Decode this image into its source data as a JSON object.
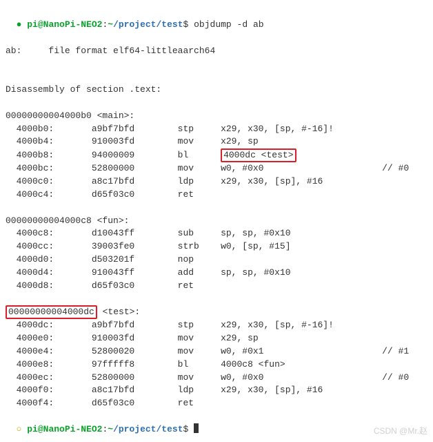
{
  "prompt1": {
    "bullet": "●",
    "userhost": "pi@NanoPi-NEO2",
    "colon": ":",
    "tilde": "~",
    "path": "/project/test",
    "dollar": "$",
    "command": "objdump -d ab"
  },
  "file_line": "ab:     file format elf64-littleaarch64",
  "section_line": "Disassembly of section .text:",
  "main": {
    "header": "00000000004000b0 <main>:",
    "rows": [
      {
        "addr": "  4000b0:",
        "hex": "a9bf7bfd",
        "mnemonic": "stp",
        "ops": "x29, x30, [sp, #-16]!",
        "comment": ""
      },
      {
        "addr": "  4000b4:",
        "hex": "910003fd",
        "mnemonic": "mov",
        "ops": "x29, sp",
        "comment": ""
      },
      {
        "addr": "  4000b8:",
        "hex": "94000009",
        "mnemonic": "bl",
        "ops": "4000dc <test>",
        "comment": "",
        "highlight_ops": true
      },
      {
        "addr": "  4000bc:",
        "hex": "52800000",
        "mnemonic": "mov",
        "ops": "w0, #0x0",
        "comment": "// #0"
      },
      {
        "addr": "  4000c0:",
        "hex": "a8c17bfd",
        "mnemonic": "ldp",
        "ops": "x29, x30, [sp], #16",
        "comment": ""
      },
      {
        "addr": "  4000c4:",
        "hex": "d65f03c0",
        "mnemonic": "ret",
        "ops": "",
        "comment": ""
      }
    ]
  },
  "fun": {
    "header": "00000000004000c8 <fun>:",
    "rows": [
      {
        "addr": "  4000c8:",
        "hex": "d10043ff",
        "mnemonic": "sub",
        "ops": "sp, sp, #0x10",
        "comment": ""
      },
      {
        "addr": "  4000cc:",
        "hex": "39003fe0",
        "mnemonic": "strb",
        "ops": "w0, [sp, #15]",
        "comment": ""
      },
      {
        "addr": "  4000d0:",
        "hex": "d503201f",
        "mnemonic": "nop",
        "ops": "",
        "comment": ""
      },
      {
        "addr": "  4000d4:",
        "hex": "910043ff",
        "mnemonic": "add",
        "ops": "sp, sp, #0x10",
        "comment": ""
      },
      {
        "addr": "  4000d8:",
        "hex": "d65f03c0",
        "mnemonic": "ret",
        "ops": "",
        "comment": ""
      }
    ]
  },
  "test": {
    "header_addr": "00000000004000dc",
    "header_sym": " <test>:",
    "rows": [
      {
        "addr": "  4000dc:",
        "hex": "a9bf7bfd",
        "mnemonic": "stp",
        "ops": "x29, x30, [sp, #-16]!",
        "comment": ""
      },
      {
        "addr": "  4000e0:",
        "hex": "910003fd",
        "mnemonic": "mov",
        "ops": "x29, sp",
        "comment": ""
      },
      {
        "addr": "  4000e4:",
        "hex": "52800020",
        "mnemonic": "mov",
        "ops": "w0, #0x1",
        "comment": "// #1"
      },
      {
        "addr": "  4000e8:",
        "hex": "97fffff8",
        "mnemonic": "bl",
        "ops": "4000c8 <fun>",
        "comment": ""
      },
      {
        "addr": "  4000ec:",
        "hex": "52800000",
        "mnemonic": "mov",
        "ops": "w0, #0x0",
        "comment": "// #0"
      },
      {
        "addr": "  4000f0:",
        "hex": "a8c17bfd",
        "mnemonic": "ldp",
        "ops": "x29, x30, [sp], #16",
        "comment": ""
      },
      {
        "addr": "  4000f4:",
        "hex": "d65f03c0",
        "mnemonic": "ret",
        "ops": "",
        "comment": ""
      }
    ]
  },
  "prompt2": {
    "bullet": "○",
    "userhost": "pi@NanoPi-NEO2",
    "colon": ":",
    "tilde": "~",
    "path": "/project/test",
    "dollar": "$"
  },
  "watermark": "CSDN @Mr.赵"
}
